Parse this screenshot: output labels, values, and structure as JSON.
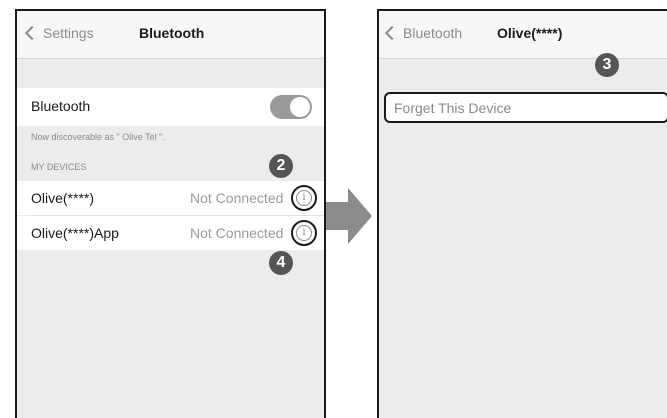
{
  "left_screen": {
    "nav": {
      "back_label": "Settings",
      "title": "Bluetooth"
    },
    "bluetooth_row": {
      "label": "Bluetooth",
      "toggle_on": true
    },
    "discoverable_text": "Now discoverable as \" Olive Tel \".",
    "section_header": "MY DEVICES",
    "devices": [
      {
        "name": "Olive(****)",
        "status": "Not Connected",
        "step": "2"
      },
      {
        "name": "Olive(****)App",
        "status": "Not Connected",
        "step": "4"
      }
    ],
    "info_glyph": "i"
  },
  "right_screen": {
    "nav": {
      "back_label": "Bluetooth",
      "title": "Olive(****)"
    },
    "step": "3",
    "forget_label": "Forget This Device"
  },
  "icons": {
    "back": "chevron-left-icon",
    "info": "info-circle-icon",
    "flow": "arrow-right-icon"
  },
  "colors": {
    "step_badge": "#555555",
    "toggle_track": "#9a9a9a",
    "flow_arrow": "#8c8c8c"
  }
}
